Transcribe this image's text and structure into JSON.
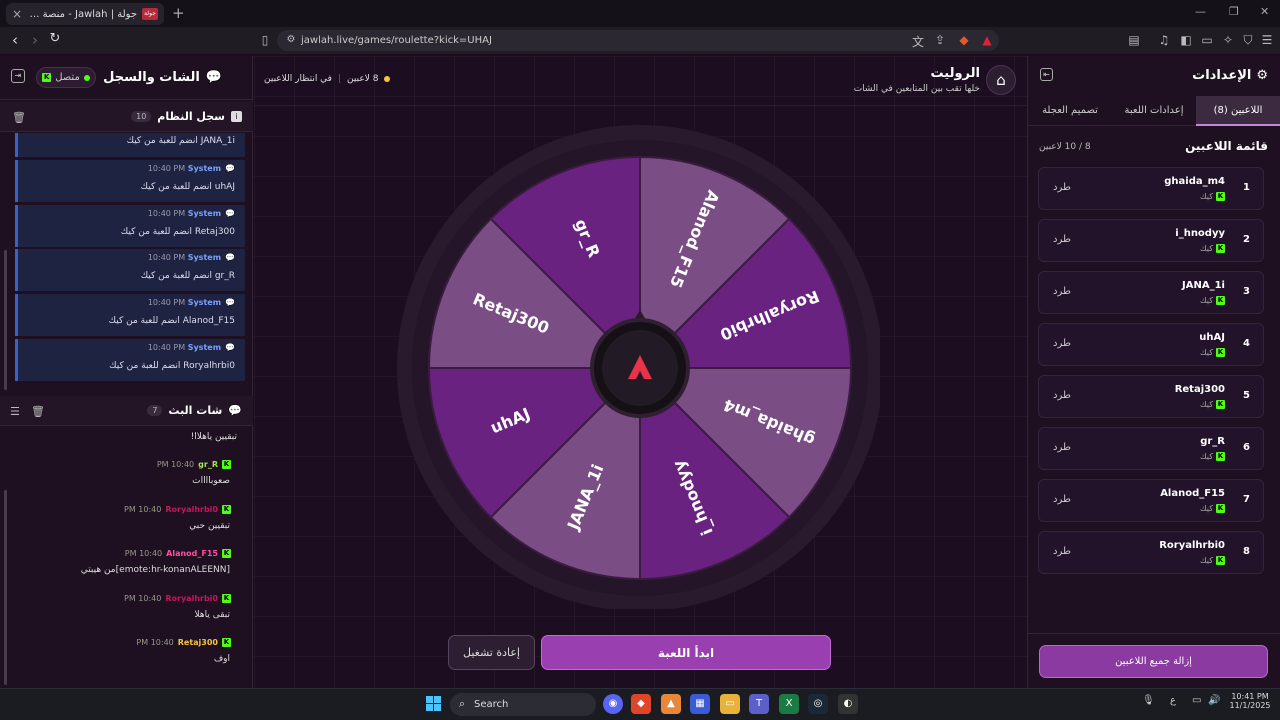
{
  "browser": {
    "tab_title": "جولة | Jawlah - منصة الألعاب التفا",
    "tab_favicon": "جولة",
    "url": "jawlah.live/games/roulette?kick=UHAJ"
  },
  "left_panel": {
    "title": "الشات والسجل",
    "status": "متصل",
    "system_log": {
      "title": "سجل النظام",
      "count": "10",
      "partial_msg": "JANA_1i انضم للعبة من كيك",
      "items": [
        {
          "sender": "System",
          "time": "10:40 PM",
          "text": "uhAJ انضم للعبة من كيك"
        },
        {
          "sender": "System",
          "time": "10:40 PM",
          "text": "Retaj300 انضم للعبة من كيك"
        },
        {
          "sender": "System",
          "time": "10:40 PM",
          "text": "gr_R انضم للعبة من كيك"
        },
        {
          "sender": "System",
          "time": "10:40 PM",
          "text": "Alanod_F15 انضم للعبة من كيك"
        },
        {
          "sender": "System",
          "time": "10:40 PM",
          "text": "Roryalhrbi0 انضم للعبة من كيك"
        }
      ]
    },
    "stream_chat": {
      "title": "شات البث",
      "count": "7",
      "partial_msg": "تبقيين ياهلاا!",
      "items": [
        {
          "user": "gr_R",
          "time": "10:40 PM",
          "text": "صعوباااات",
          "color": "#a6e34a"
        },
        {
          "user": "Roryalhrbi0",
          "time": "10:40 PM",
          "text": "تبقيين حبي",
          "color": "#c2185b"
        },
        {
          "user": "Alanod_F15",
          "time": "10:40 PM",
          "text": "[emote:hr-konanALEENN]من هيبتي",
          "color": "#ff4fa0"
        },
        {
          "user": "Roryalhrbi0",
          "time": "10:40 PM",
          "text": "تبقى ياهلا",
          "color": "#c2185b"
        },
        {
          "user": "Retaj300",
          "time": "10:40 PM",
          "text": "اوف",
          "color": "#f4c542"
        }
      ]
    }
  },
  "center": {
    "title": "الروليت",
    "subtitle": "خلها تقب بين المتابعين في الشات",
    "players_count": "8 لاعبين",
    "waiting": "في انتظار اللاعبين",
    "start_btn": "ابدأ اللعبة",
    "restart_btn": "إعادة تشغيل"
  },
  "chart_data": {
    "type": "pie",
    "categories": [
      "Alanod_F15",
      "Roryalhrbi0",
      "ghaida_m4",
      "i_hnodyy",
      "JANA_1i",
      "uhAJ",
      "Retaj300",
      "gr_R"
    ],
    "values": [
      1,
      1,
      1,
      1,
      1,
      1,
      1,
      1
    ],
    "colors": [
      "#7a4d84",
      "#6a2280",
      "#7a4d84",
      "#6a2280",
      "#7a4d84",
      "#6a2280",
      "#7a4d84",
      "#6a2280"
    ]
  },
  "right_panel": {
    "title": "الإعدادات",
    "tabs": [
      "اللاعبين (8)",
      "إعدادات اللعبة",
      "تصميم العجلة"
    ],
    "list_title": "قائمة اللاعبين",
    "capacity": "8 / 10 لاعبين",
    "kick_label": "طرد",
    "source": "كيك",
    "players": [
      {
        "n": "1",
        "name": "ghaida_m4"
      },
      {
        "n": "2",
        "name": "i_hnodyy"
      },
      {
        "n": "3",
        "name": "JANA_1i"
      },
      {
        "n": "4",
        "name": "uhAJ"
      },
      {
        "n": "5",
        "name": "Retaj300"
      },
      {
        "n": "6",
        "name": "gr_R"
      },
      {
        "n": "7",
        "name": "Alanod_F15"
      },
      {
        "n": "8",
        "name": "Roryalhrbi0"
      }
    ],
    "remove_all": "إزالة جميع اللاعبين"
  },
  "taskbar": {
    "search": "Search",
    "time": "10:41 PM",
    "date": "11/1/2025",
    "lang": "ع"
  }
}
